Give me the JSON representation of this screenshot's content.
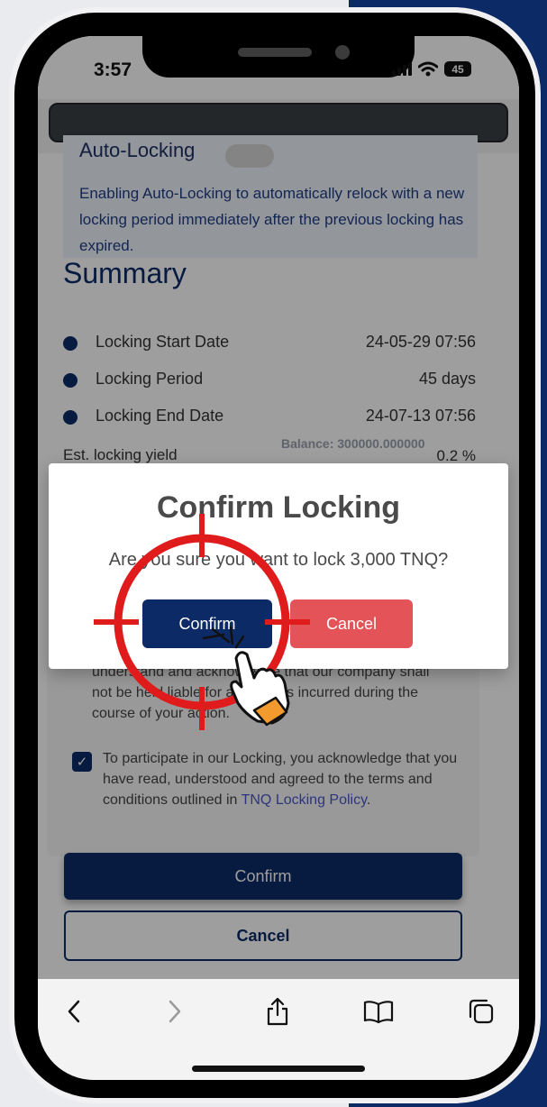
{
  "status_bar": {
    "time": "3:57",
    "battery": "45"
  },
  "page": {
    "autolock": {
      "title": "Auto-Locking",
      "description": "Enabling Auto-Locking to automatically relock with a new locking period immediately after the previous locking has expired."
    },
    "summary": {
      "title": "Summary",
      "rows": [
        {
          "label": "Locking Start Date",
          "value": "24-05-29 07:56"
        },
        {
          "label": "Locking Period",
          "value": "45 days"
        },
        {
          "label": "Locking End Date",
          "value": "24-07-13 07:56"
        }
      ],
      "yield_label": "Est. locking yield",
      "yield_value": "0.2 %",
      "balance": "Balance: 300000.000000"
    },
    "terms": {
      "text1": "understand and acknowledge that our company shall not be held liable for any losses incurred during the course of your action.",
      "text2": "To participate in our Locking, you acknowledge that you have read, understood and agreed to the terms and conditions outlined in",
      "policy_link": "TNQ Locking Policy",
      "text2_end": ".",
      "checkbox_checked": true
    },
    "confirm_label": "Confirm",
    "cancel_label": "Cancel"
  },
  "modal": {
    "title": "Confirm Locking",
    "message": "Are you sure you want to lock 3,000 TNQ?",
    "confirm_label": "Confirm",
    "cancel_label": "Cancel"
  },
  "toolbar": {
    "icons": [
      "back-icon",
      "forward-icon",
      "share-icon",
      "bookmarks-icon",
      "tabs-icon"
    ]
  },
  "colors": {
    "navy": "#0c2a66",
    "cancel_red": "#e35358",
    "annotation_red": "#e01b1b"
  }
}
